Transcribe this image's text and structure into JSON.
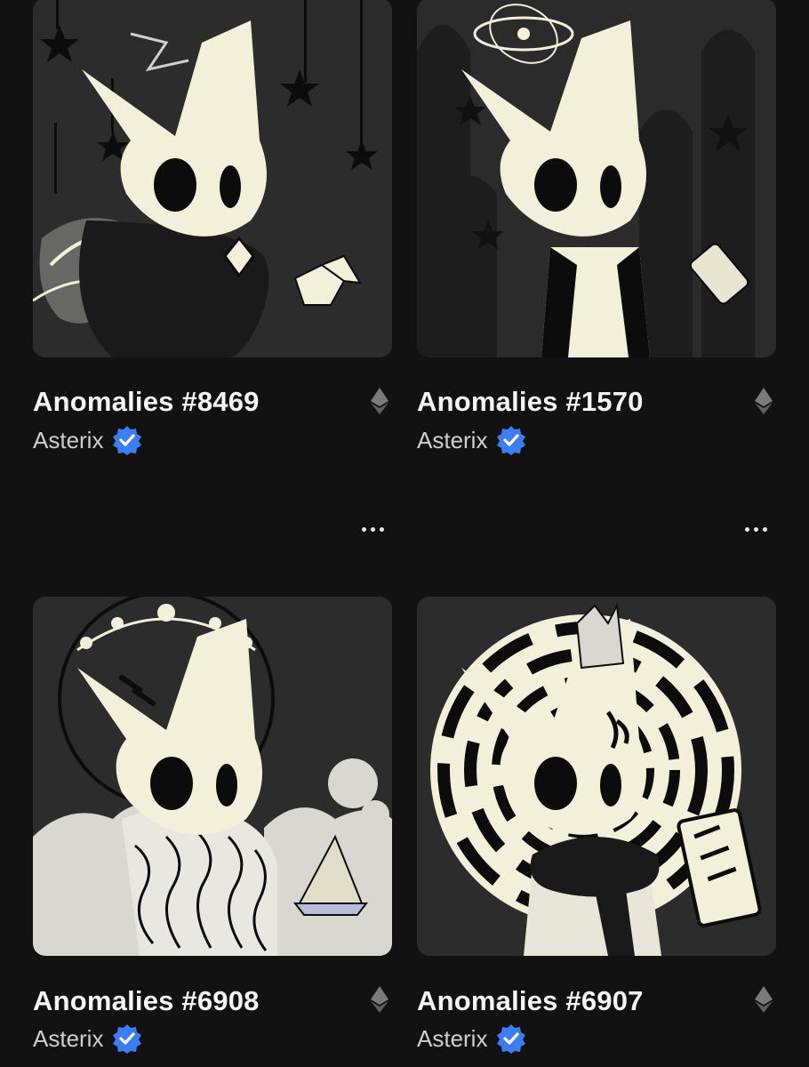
{
  "grid": {
    "cards": [
      {
        "title": "Anomalies #8469",
        "creator": "Asterix",
        "chain_icon": "ethereum-icon",
        "verified_icon": "verified-badge-icon",
        "more_icon": "more-horizontal-icon"
      },
      {
        "title": "Anomalies #1570",
        "creator": "Asterix",
        "chain_icon": "ethereum-icon",
        "verified_icon": "verified-badge-icon",
        "more_icon": "more-horizontal-icon"
      },
      {
        "title": "Anomalies #6908",
        "creator": "Asterix",
        "chain_icon": "ethereum-icon",
        "verified_icon": "verified-badge-icon",
        "more_icon": "more-horizontal-icon"
      },
      {
        "title": "Anomalies #6907",
        "creator": "Asterix",
        "chain_icon": "ethereum-icon",
        "verified_icon": "verified-badge-icon",
        "more_icon": "more-horizontal-icon"
      }
    ]
  },
  "colors": {
    "background": "#121213",
    "card_image_bg": "#2a2a2b",
    "character_cream": "#f2f0d8",
    "verified_blue": "#3d7df2",
    "text_primary": "#f5f5f5",
    "text_secondary": "#cfcfcf"
  }
}
